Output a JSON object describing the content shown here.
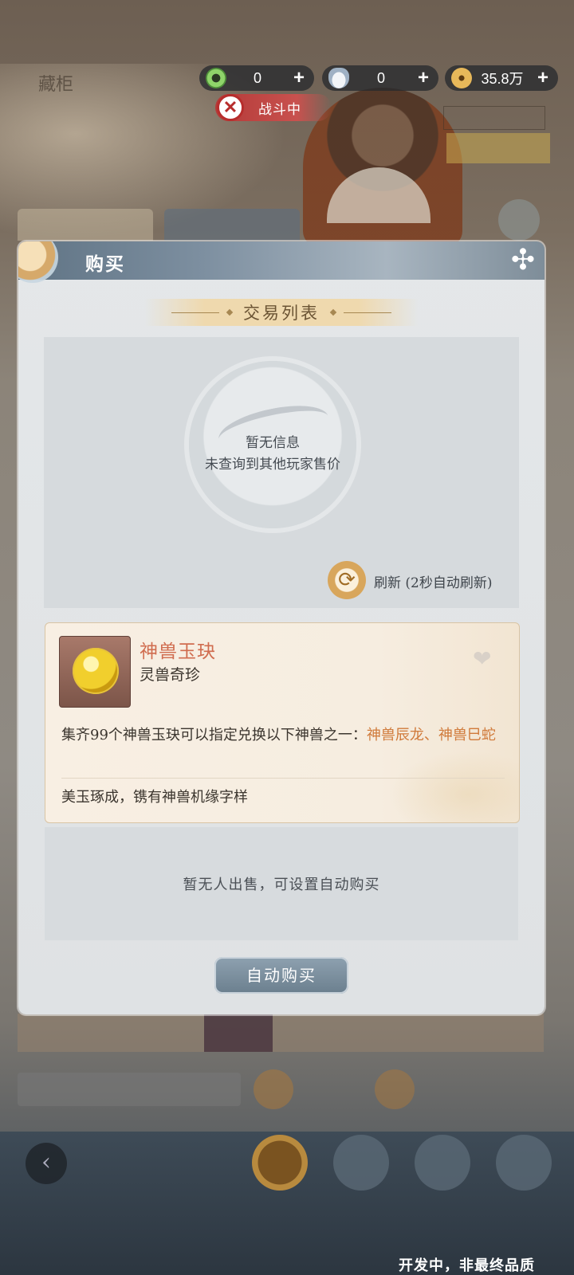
{
  "currency": [
    {
      "icon": "jade-icon",
      "value": "0"
    },
    {
      "icon": "silver-ingot-icon",
      "value": "0"
    },
    {
      "icon": "copper-coin-icon",
      "value": "35.8万"
    }
  ],
  "status": {
    "battle_label": "战斗中"
  },
  "dialog": {
    "title": "购买",
    "section_title": "交易列表",
    "empty_title": "暂无信息",
    "empty_subtitle": "未查询到其他玩家售价",
    "refresh_label": "刷新 (2秒自动刷新)"
  },
  "item": {
    "name": "神兽玉玦",
    "category": "灵兽奇珍",
    "description_prefix": "集齐99个神兽玉玦可以指定兑换以下神兽之一：",
    "highlight_1": "神兽辰龙、",
    "highlight_2": "神兽巳蛇",
    "flavor": "美玉琢成，镌有神兽机缘字样"
  },
  "seller": {
    "empty_message": "暂无人出售，可设置自动购买"
  },
  "buttons": {
    "auto_buy": "自动购买"
  },
  "watermark": "开发中，非最终品质",
  "colors": {
    "item_name": "#d06c4f",
    "highlight": "#d07a3a",
    "battle": "#b43a38"
  }
}
